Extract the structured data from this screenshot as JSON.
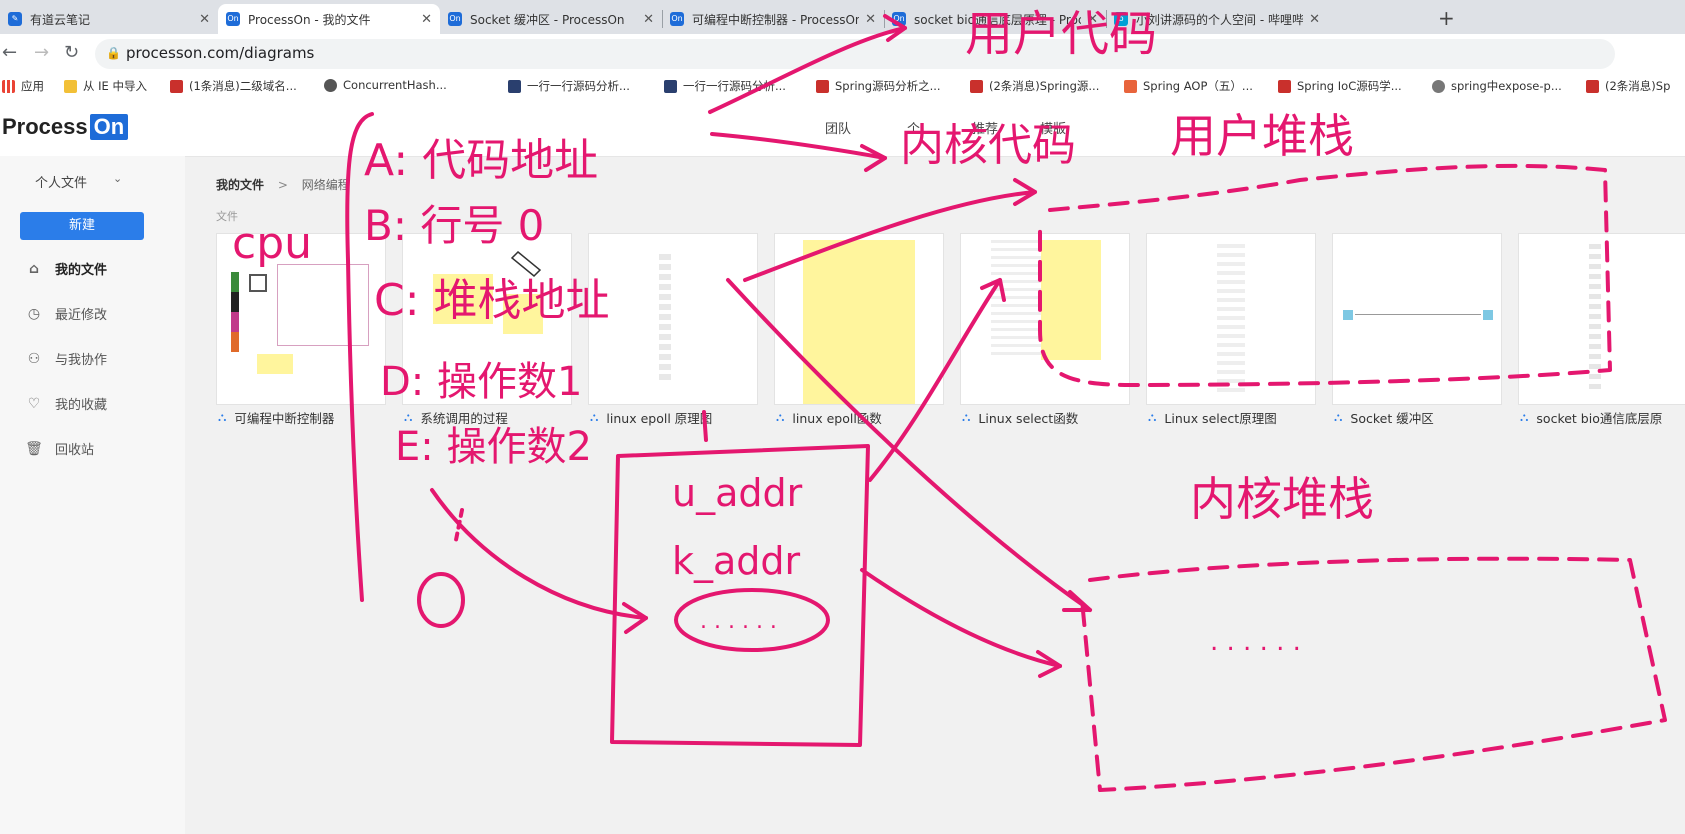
{
  "tabs": [
    {
      "label": "有道云笔记",
      "icon": "youdao-note-icon",
      "active": false
    },
    {
      "label": "ProcessOn - 我的文件",
      "icon": "processon-icon",
      "active": true
    },
    {
      "label": "Socket 缓冲区 - ProcessOn",
      "icon": "processon-icon",
      "active": false
    },
    {
      "label": "可编程中断控制器 - ProcessOn",
      "icon": "processon-icon",
      "active": false
    },
    {
      "label": "socket bio通信底层原理 - Proc",
      "icon": "processon-icon",
      "active": false
    },
    {
      "label": "小刘讲源码的个人空间 - 哔哩哔哩",
      "icon": "bilibili-icon",
      "active": false
    }
  ],
  "address": {
    "url": "processon.com/diagrams"
  },
  "bookmarks": [
    {
      "label": "应用",
      "icon": "apps-grid-icon",
      "color": "#ea4335"
    },
    {
      "label": "从 IE 中导入",
      "icon": "folder-icon",
      "color": "#f2c037"
    },
    {
      "label": "(1条消息)二级域名...",
      "icon": "csdn-icon",
      "color": "#c9302c"
    },
    {
      "label": "ConcurrentHash...",
      "icon": "globe-icon",
      "color": "#555555"
    },
    {
      "label": "一行一行源码分析...",
      "icon": "site-icon",
      "color": "#2a3f6e"
    },
    {
      "label": "一行一行源码分析...",
      "icon": "site-icon",
      "color": "#2a3f6e"
    },
    {
      "label": "Spring源码分析之...",
      "icon": "csdn-icon",
      "color": "#c9302c"
    },
    {
      "label": "(2条消息)Spring源...",
      "icon": "csdn-icon",
      "color": "#c9302c"
    },
    {
      "label": "Spring AOP（五）...",
      "icon": "jianshu-icon",
      "color": "#e8643c"
    },
    {
      "label": "Spring IoC源码学...",
      "icon": "csdn-icon",
      "color": "#c9302c"
    },
    {
      "label": "spring中expose-p...",
      "icon": "link-icon",
      "color": "#777777"
    },
    {
      "label": "(2条消息)Sp",
      "icon": "csdn-icon",
      "color": "#c9302c"
    }
  ],
  "app": {
    "logo_text": "Process",
    "logo_badge": "On",
    "nav": [
      "团队",
      "个",
      "推荐",
      "模版"
    ]
  },
  "sidebar": {
    "personal_label": "个人文件",
    "new_button": "新建",
    "items": [
      {
        "label": "我的文件",
        "icon": "home-icon",
        "active": true
      },
      {
        "label": "最近修改",
        "icon": "clock-icon",
        "active": false
      },
      {
        "label": "与我协作",
        "icon": "users-icon",
        "active": false
      },
      {
        "label": "我的收藏",
        "icon": "heart-icon",
        "active": false
      },
      {
        "label": "回收站",
        "icon": "trash-icon",
        "active": false
      }
    ]
  },
  "breadcrumb": {
    "root": "我的文件",
    "separator": ">",
    "current": "网络编程"
  },
  "section_label": "文件",
  "files": [
    {
      "name": "可编程中断控制器"
    },
    {
      "name": "系统调用的过程"
    },
    {
      "name": "linux epoll 原理图"
    },
    {
      "name": "linux epoll函数"
    },
    {
      "name": "Linux select函数"
    },
    {
      "name": "Linux select原理图"
    },
    {
      "name": "Socket 缓冲区"
    },
    {
      "name": "socket bio通信底层原"
    }
  ],
  "annotations": {
    "user_code": "用户代码",
    "kernel_code": "内核代码",
    "user_stack": "用户堆栈",
    "kernel_stack": "内核堆栈",
    "cpu": "cpu",
    "line_a": "A: 代码地址",
    "line_b": "B: 行号 0",
    "line_c": "C: 堆栈地址",
    "line_d": "D: 操作数1",
    "line_e": "E: 操作数2",
    "box_u": "u_addr",
    "box_k": "k_addr",
    "circle_1": "①",
    "dots": ". . . . . ."
  },
  "colors": {
    "ink": "#e4176f",
    "brand": "#1e6cd8",
    "button": "#2b7de9"
  }
}
